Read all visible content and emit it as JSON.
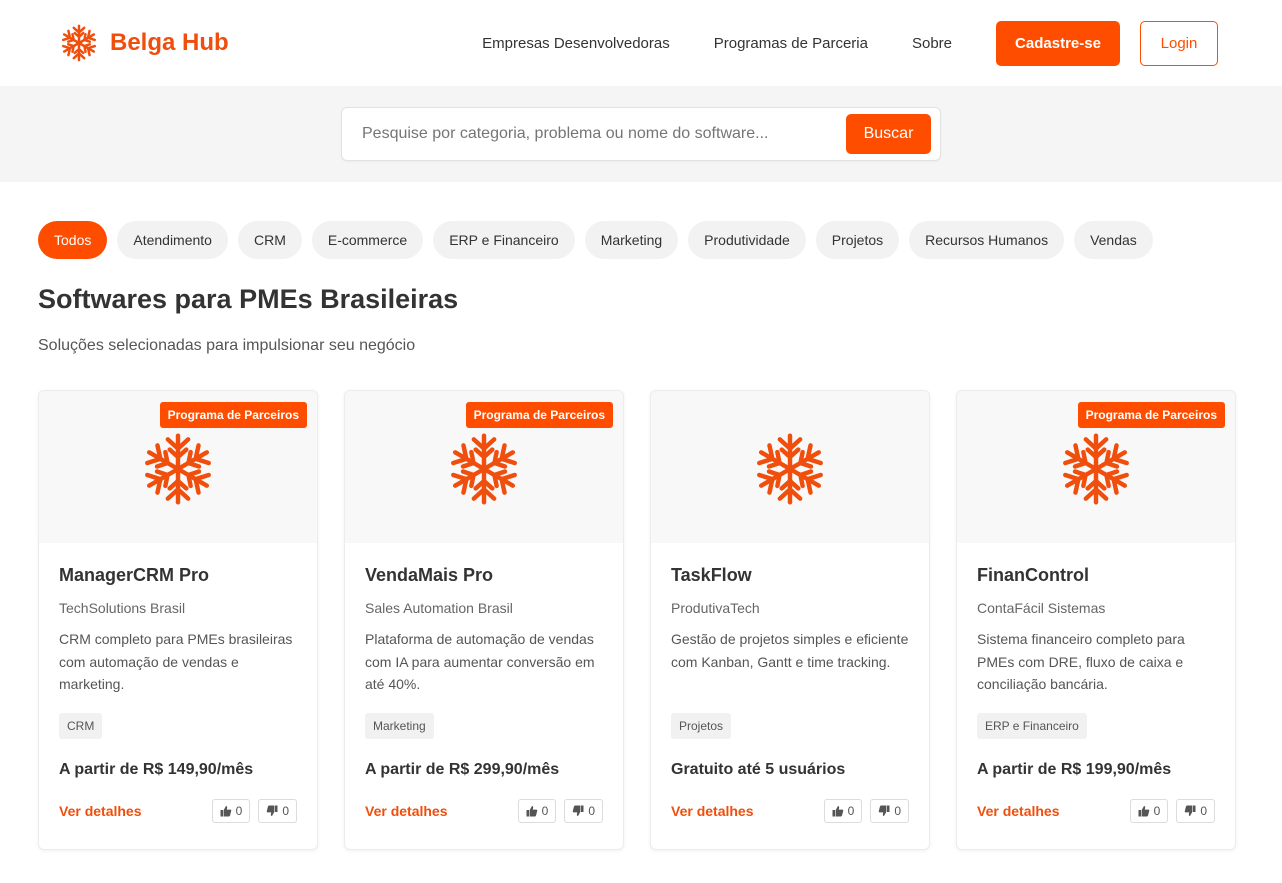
{
  "brand": {
    "name": "Belga Hub",
    "logo_icon": "snowflake-icon",
    "accent_color": "#ff4d00"
  },
  "nav": {
    "links": [
      "Empresas Desenvolvedoras",
      "Programas de Parceria",
      "Sobre"
    ],
    "signup_label": "Cadastre-se",
    "login_label": "Login"
  },
  "search": {
    "placeholder": "Pesquise por categoria, problema ou nome do software...",
    "value": "",
    "button_label": "Buscar"
  },
  "categories": {
    "items": [
      "Todos",
      "Atendimento",
      "CRM",
      "E-commerce",
      "ERP e Financeiro",
      "Marketing",
      "Produtividade",
      "Projetos",
      "Recursos Humanos",
      "Vendas"
    ],
    "active": "Todos"
  },
  "main": {
    "title": "Softwares para PMEs Brasileiras",
    "subtitle": "Soluções selecionadas para impulsionar seu negócio"
  },
  "products": [
    {
      "badge": "Programa de Parceiros",
      "name": "ManagerCRM Pro",
      "company": "TechSolutions Brasil",
      "description": "CRM completo para PMEs brasileiras com automação de vendas e marketing.",
      "tag": "CRM",
      "price": "A partir de R$ 149,90/mês",
      "details_label": "Ver detalhes",
      "likes": "0",
      "dislikes": "0"
    },
    {
      "badge": "Programa de Parceiros",
      "name": "VendaMais Pro",
      "company": "Sales Automation Brasil",
      "description": "Plataforma de automação de vendas com IA para aumentar conversão em até 40%.",
      "tag": "Marketing",
      "price": "A partir de R$ 299,90/mês",
      "details_label": "Ver detalhes",
      "likes": "0",
      "dislikes": "0"
    },
    {
      "badge": "",
      "name": "TaskFlow",
      "company": "ProdutivaTech",
      "description": "Gestão de projetos simples e eficiente com Kanban, Gantt e time tracking.",
      "tag": "Projetos",
      "price": "Gratuito até 5 usuários",
      "details_label": "Ver detalhes",
      "likes": "0",
      "dislikes": "0"
    },
    {
      "badge": "Programa de Parceiros",
      "name": "FinanControl",
      "company": "ContaFácil Sistemas",
      "description": "Sistema financeiro completo para PMEs com DRE, fluxo de caixa e conciliação bancária.",
      "tag": "ERP e Financeiro",
      "price": "A partir de R$ 199,90/mês",
      "details_label": "Ver detalhes",
      "likes": "0",
      "dislikes": "0"
    }
  ]
}
